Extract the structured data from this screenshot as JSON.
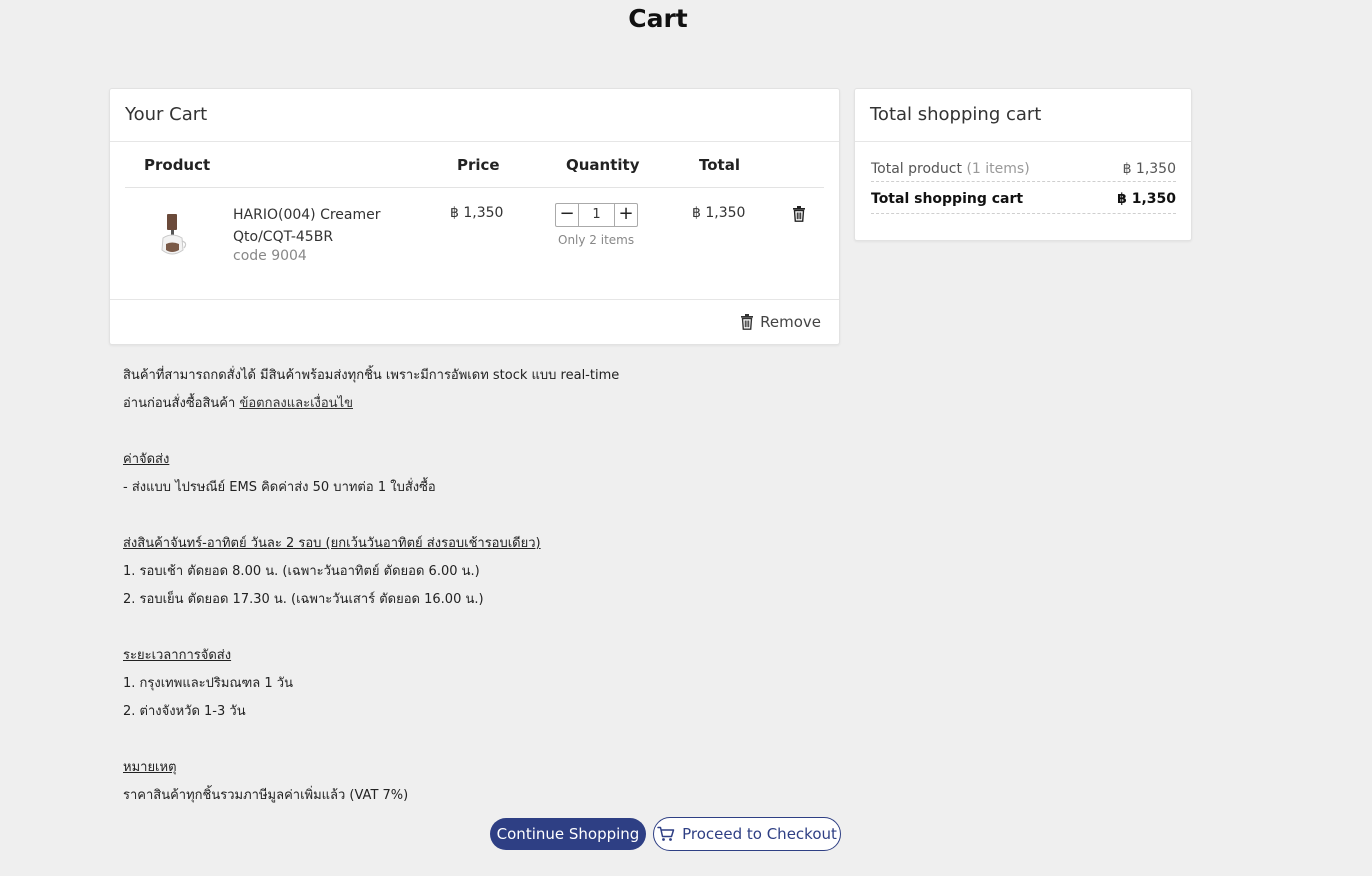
{
  "page": {
    "title": "Cart"
  },
  "cart": {
    "header": "Your Cart",
    "columns": {
      "product": "Product",
      "price": "Price",
      "quantity": "Quantity",
      "total": "Total"
    },
    "items": [
      {
        "name": "HARIO(004) Creamer Qto/CQT-45BR",
        "code": "code 9004",
        "price": "฿ 1,350",
        "quantity": "1",
        "stock_note": "Only 2 items",
        "total": "฿ 1,350"
      }
    ],
    "remove_label": "Remove",
    "minus": "−",
    "plus": "+"
  },
  "summary": {
    "header": "Total shopping cart",
    "product_label": "Total product",
    "product_count": "(1 items)",
    "product_value": "฿ 1,350",
    "total_label": "Total shopping cart",
    "total_value": "฿ 1,350"
  },
  "info": {
    "line1": "สินค้าที่สามารถกดสั่งได้ มีสินค้าพร้อมส่งทุกชิ้น เพราะมีการอัพเดท stock แบบ real-time",
    "line2_prefix": "อ่านก่อนสั่งซื้อสินค้า",
    "line2_link": "ข้อตกลงและเงื่อนไข",
    "shipping_title": "ค่าจัดส่ง",
    "shipping_line": "- ส่งแบบ ไปรษณีย์ EMS คิดค่าส่ง 50 บาทต่อ 1 ใบสั่งซื้อ",
    "delivery_title": "ส่งสินค้าจันทร์-อาทิตย์ วันละ 2 รอบ (ยกเว้นวันอาทิตย์ ส่งรอบเช้ารอบเดียว)",
    "delivery_1": "1. รอบเช้า ตัดยอด 8.00 น. (เฉพาะวันอาทิตย์ ตัดยอด 6.00 น.)",
    "delivery_2": "2. รอบเย็น ตัดยอด 17.30 น. (เฉพาะวันเสาร์ ตัดยอด 16.00 น.)",
    "duration_title": "ระยะเวลาการจัดส่ง",
    "duration_1": "1. กรุงเทพและปริมณฑล 1 วัน",
    "duration_2": "2. ต่างจังหวัด 1-3 วัน",
    "note_title": "หมายเหตุ",
    "note_line": "ราคาสินค้าทุกชิ้นรวมภาษีมูลค่าเพิ่มแล้ว (VAT 7%)"
  },
  "actions": {
    "continue_label": "Continue Shopping",
    "checkout_label": "Proceed to Checkout"
  },
  "colors": {
    "primary": "#2e3f84",
    "background": "#efefef",
    "highlight": "#e0101e"
  }
}
